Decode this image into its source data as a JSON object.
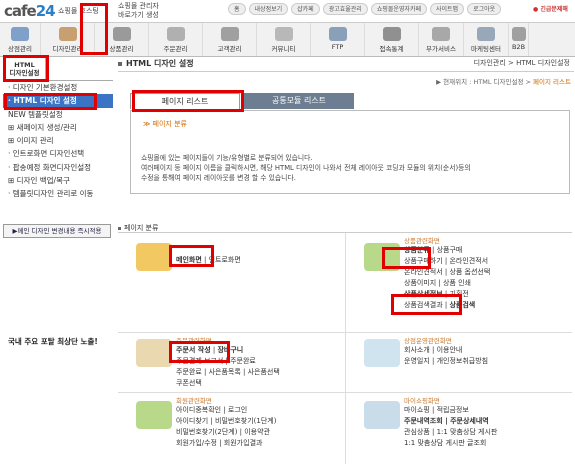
{
  "header": {
    "logo_main": "cafe",
    "logo_num": "24",
    "logo_sub": "쇼핑몰 호스팅",
    "shortcut_line1": "쇼핑몰 관리자",
    "shortcut_line2": "바로가기 생성",
    "top_links": [
      "홈",
      "내상점보기",
      "샵카페",
      "광고효율관리",
      "쇼핑몰운영자카페",
      "사이트맵",
      "로그아웃"
    ],
    "exit_label": "긴급문제해"
  },
  "menubar": {
    "items": [
      {
        "label": "상점관리",
        "icon": "store-icon",
        "color": "#7fa0c8"
      },
      {
        "label": "디자인관리",
        "icon": "design-icon",
        "color": "#c8a070"
      },
      {
        "label": "상품관리",
        "icon": "product-icon",
        "color": "#9a9a9a"
      },
      {
        "label": "주문관리",
        "icon": "order-icon",
        "color": "#b0b0b0"
      },
      {
        "label": "고객관리",
        "icon": "customer-icon",
        "color": "#a0a0a0"
      },
      {
        "label": "커뮤니티",
        "icon": "community-icon",
        "color": "#b8b8b8"
      },
      {
        "label": "FTP",
        "icon": "ftp-icon",
        "color": "#8aa0b8"
      },
      {
        "label": "접속통계",
        "icon": "stats-icon",
        "color": "#909090"
      },
      {
        "label": "부가서비스",
        "icon": "service-icon",
        "color": "#a8a8a8"
      },
      {
        "label": "마케팅센터",
        "icon": "marketing-icon",
        "color": "#98a8b8"
      },
      {
        "label": "B2B",
        "icon": "b2b-icon",
        "color": "#a0a0a0"
      }
    ],
    "marketing_badge": "네이버 지식쇼핑"
  },
  "sidebar": {
    "tab_line1": "HTML",
    "tab_line2": "디자인설정",
    "items": [
      "디자인 기본환경설정",
      "HTML 디자인 설정",
      "NEW 템플릿설정",
      "새페이지 생성/관리",
      "이미지 관리",
      "인트로화면 디자인선택",
      "팝송예정 화면디자인설정",
      "디자인 백업/복구",
      "템플릿디자인 관리로 이동"
    ],
    "apply_button": "메인 디자인 변경내용 즉시적용",
    "notice": "국내 주요 포탈 최상단 노출!"
  },
  "main": {
    "title": "HTML 디자인 설정",
    "title_right": "디자인관리 > HTML 디자인설정",
    "breadcrumb_prefix": "▶ 현재위치 : HTML 디자인설정 > ",
    "breadcrumb_current": "페이지 리스트",
    "tab_active": "페이지 리스트",
    "tab_inactive": "공통모듈 리스트",
    "info_title": "≫ 페이지 분류",
    "info_line1": "쇼핑몰에 있는 페이지들이 기능/유형별로 분류되어 있습니다.",
    "info_line2": "여러페이지 등 페이지 이름을 클릭하시면, 해당 HTML 디자인이 나와서 전체 레이아웃 코딩과 모듈의 위치(순서)등의",
    "info_line3": "수정을 통해여 페이지 레이아웃를 변경 할 수 있습니다.",
    "section_title": "페이지 분류"
  },
  "categories": [
    {
      "cat": "",
      "lines": [
        [
          "메인화면",
          "인트로화면"
        ]
      ]
    },
    {
      "cat": "상품관련화면",
      "lines": [
        [
          "상품분류",
          "상품구매"
        ],
        [
          "상품구매하기",
          "온라인견적서"
        ],
        [
          "온라인견적서 | 상품 옵션선택"
        ],
        [
          "상품이미지 | 상품 인쇄"
        ],
        [
          "상품상세정보",
          "기획전"
        ],
        [
          "상품검색결과",
          "상품검색"
        ]
      ]
    },
    {
      "cat": "주문관련화면",
      "lines": [
        [
          "주문서 작성",
          "장바구니"
        ],
        [
          "주문결제 보고서 | 주문완료"
        ],
        [
          "주문완료 | 사은품목록 | 사은품선택"
        ],
        [
          "쿠폰선택"
        ]
      ]
    },
    {
      "cat": "상점운영관련화면",
      "lines": [
        [
          "회사소개 | 이용안내"
        ],
        [
          "운영일지 | 개인정보취급방침"
        ]
      ]
    },
    {
      "cat": "회원관련화면",
      "lines": [
        [
          "아이디중복확인 | 로그인"
        ],
        [
          "아이디찾기 | 비밀번호찾기(1단계)"
        ],
        [
          "비밀번호찾기(2단계) | 이용약관"
        ],
        [
          "회원가입/수정 | 회원가입결과"
        ]
      ]
    },
    {
      "cat": "마이쇼핑화면",
      "lines": [
        [
          "마이쇼핑 | 적립금정보"
        ],
        [
          "주문내역조회 | 주문상세내역"
        ],
        [
          "관심상품 | 1:1 맞춤상담 게시판"
        ],
        [
          "1:1 맞춤상담 게시판 글조회"
        ]
      ]
    }
  ]
}
